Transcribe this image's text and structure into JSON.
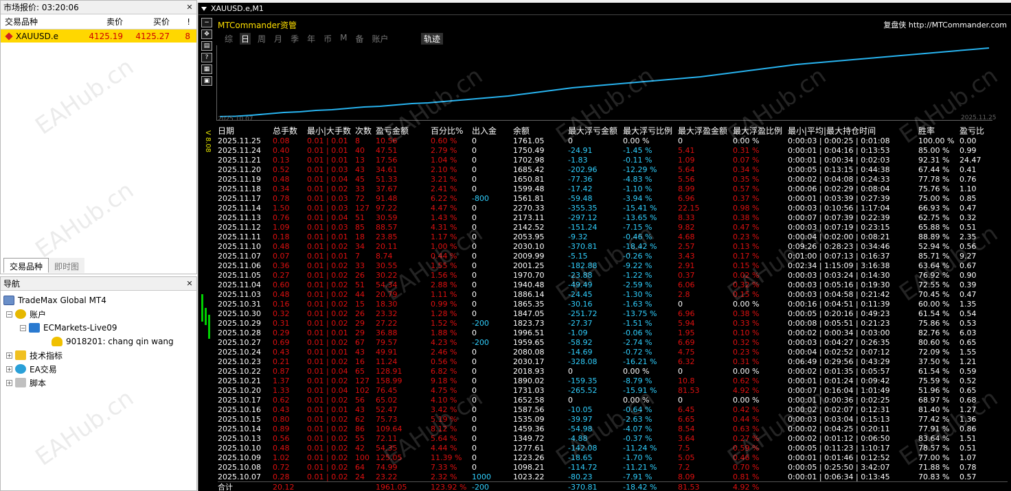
{
  "market_watch": {
    "title": "市场报价: 03:20:06",
    "columns": [
      "交易品种",
      "卖价",
      "买价",
      "!"
    ],
    "rows": [
      {
        "symbol": "XAUUSD.e",
        "bid": "4125.19",
        "ask": "4125.27",
        "spread": "8"
      }
    ],
    "tabs": [
      "交易品种",
      "即时图"
    ]
  },
  "navigator": {
    "title": "导航",
    "tree": {
      "terminal": "TradeMax Global MT4",
      "accounts": "账户",
      "server": "ECMarkets-Live09",
      "user": "9018201: chang qin wang",
      "indicators": "技术指标",
      "ea": "EA交易",
      "scripts": "脚本"
    }
  },
  "chart": {
    "title": "XAUUSD.e,M1",
    "brand": "MTCommander资管",
    "brand_right_label": "复盘侠",
    "brand_right_url": "http://MTCommander.com",
    "price_label": "V 8.08",
    "periods": [
      "综",
      "日",
      "周",
      "月",
      "季",
      "年",
      "币",
      "M",
      "备",
      "账户"
    ],
    "active_period": "日",
    "track": "轨迹",
    "date_start": "2025.10.07",
    "date_end": "2025.11.25",
    "watermark": "EAHub.cn"
  },
  "chart_data": {
    "type": "line",
    "series": [
      {
        "values": [
          0,
          0.5,
          2,
          4,
          6,
          7,
          9,
          10,
          12,
          14,
          15,
          17,
          19,
          20,
          22,
          24,
          26,
          28,
          30,
          33,
          36,
          39,
          42,
          44,
          46,
          48,
          50,
          52,
          54,
          56,
          58,
          61,
          64,
          67,
          70,
          73,
          76,
          78,
          80,
          82,
          84,
          86,
          88,
          90,
          92,
          94,
          96,
          98,
          100
        ]
      }
    ],
    "xlabel": "",
    "ylabel": "",
    "ylim": [
      0,
      100
    ]
  },
  "table": {
    "headers": [
      "日期",
      "总手数",
      "最小|大手数",
      "次数",
      "盈亏金额",
      "百分比%",
      "出入金",
      "余额",
      "最大浮亏金额",
      "最大浮亏比例",
      "最大浮盈金额",
      "最大浮盈比例",
      "最小|平均|最大持仓时间",
      "胜率",
      "盈亏比"
    ],
    "rows": [
      [
        "2025.11.25",
        "0.08",
        "0.01 | 0.01",
        "8",
        "10.56",
        "0.60 %",
        "0",
        "1761.05",
        "0",
        "0.00 %",
        "0",
        "0.00 %",
        "0:00:03 | 0:00:25 | 0:01:08",
        "100.00 %",
        "0.00"
      ],
      [
        "2025.11.24",
        "0.40",
        "0.01 | 0.01",
        "40",
        "47.51",
        "2.79 %",
        "0",
        "1750.49",
        "-24.91",
        "-1.45 %",
        "5.41",
        "0.31 %",
        "0:00:01 | 0:04:16 | 0:13:53",
        "85.00 %",
        "0.99"
      ],
      [
        "2025.11.21",
        "0.13",
        "0.01 | 0.01",
        "13",
        "17.56",
        "1.04 %",
        "0",
        "1702.98",
        "-1.83",
        "-0.11 %",
        "1.09",
        "0.07 %",
        "0:00:01 | 0:00:34 | 0:02:03",
        "92.31 %",
        "24.47"
      ],
      [
        "2025.11.20",
        "0.52",
        "0.01 | 0.03",
        "43",
        "34.61",
        "2.10 %",
        "0",
        "1685.42",
        "-202.96",
        "-12.29 %",
        "5.64",
        "0.34 %",
        "0:00:05 | 0:13:15 | 0:44:38",
        "67.44 %",
        "0.41"
      ],
      [
        "2025.11.19",
        "0.48",
        "0.01 | 0.04",
        "45",
        "51.33",
        "3.21 %",
        "0",
        "1650.81",
        "-77.36",
        "-4.83 %",
        "5.56",
        "0.35 %",
        "0:00:02 | 0:04:08 | 0:24:33",
        "77.78 %",
        "0.76"
      ],
      [
        "2025.11.18",
        "0.34",
        "0.01 | 0.02",
        "33",
        "37.67",
        "2.41 %",
        "0",
        "1599.48",
        "-17.42",
        "-1.10 %",
        "8.99",
        "0.57 %",
        "0:00:06 | 0:02:29 | 0:08:04",
        "75.76 %",
        "1.10"
      ],
      [
        "2025.11.17",
        "0.78",
        "0.01 | 0.03",
        "72",
        "91.48",
        "6.22 %",
        "-800",
        "1561.81",
        "-59.48",
        "-3.94 %",
        "6.96",
        "0.37 %",
        "0:00:01 | 0:03:39 | 0:27:39",
        "75.00 %",
        "0.85"
      ],
      [
        "2025.11.14",
        "1.50",
        "0.01 | 0.03",
        "127",
        "97.22",
        "4.47 %",
        "0",
        "2270.33",
        "-355.35",
        "-15.41 %",
        "22.15",
        "0.98 %",
        "0:00:03 | 0:10:56 | 1:17:04",
        "66.93 %",
        "0.47"
      ],
      [
        "2025.11.13",
        "0.76",
        "0.01 | 0.04",
        "51",
        "30.59",
        "1.43 %",
        "0",
        "2173.11",
        "-297.12",
        "-13.65 %",
        "8.33",
        "0.38 %",
        "0:00:07 | 0:07:39 | 0:22:39",
        "62.75 %",
        "0.32"
      ],
      [
        "2025.11.12",
        "1.09",
        "0.01 | 0.03",
        "85",
        "88.57",
        "4.31 %",
        "0",
        "2142.52",
        "-151.24",
        "-7.15 %",
        "9.82",
        "0.47 %",
        "0:00:03 | 0:07:19 | 0:23:15",
        "65.88 %",
        "0.51"
      ],
      [
        "2025.11.11",
        "0.18",
        "0.01 | 0.01",
        "18",
        "23.85",
        "1.17 %",
        "0",
        "2053.95",
        "-9.32",
        "-0.46 %",
        "4.68",
        "0.23 %",
        "0:00:04 | 0:02:00 | 0:08:21",
        "88.89 %",
        "2.35"
      ],
      [
        "2025.11.10",
        "0.48",
        "0.01 | 0.02",
        "34",
        "20.11",
        "1.00 %",
        "0",
        "2030.10",
        "-370.81",
        "-18.42 %",
        "2.57",
        "0.13 %",
        "0:09:26 | 0:28:23 | 0:34:46",
        "52.94 %",
        "0.56"
      ],
      [
        "2025.11.07",
        "0.07",
        "0.01 | 0.01",
        "7",
        "8.74",
        "0.44 %",
        "0",
        "2009.99",
        "-5.15",
        "-0.26 %",
        "3.43",
        "0.17 %",
        "0:01:00 | 0:07:13 | 0:16:37",
        "85.71 %",
        "9.27"
      ],
      [
        "2025.11.06",
        "0.36",
        "0.01 | 0.02",
        "33",
        "30.55",
        "1.55 %",
        "0",
        "2001.25",
        "-182.88",
        "-9.22 %",
        "2.91",
        "0.15 %",
        "0:02:34 | 1:15:09 | 3:16:38",
        "63.64 %",
        "0.67"
      ],
      [
        "2025.11.05",
        "0.27",
        "0.01 | 0.02",
        "26",
        "30.22",
        "1.56 %",
        "0",
        "1970.70",
        "-23.88",
        "-1.22 %",
        "0.37",
        "0.02 %",
        "0:00:03 | 0:03:24 | 0:14:30",
        "76.92 %",
        "0.90"
      ],
      [
        "2025.11.04",
        "0.60",
        "0.01 | 0.02",
        "51",
        "54.34",
        "2.88 %",
        "0",
        "1940.48",
        "-49.49",
        "-2.59 %",
        "6.06",
        "0.32 %",
        "0:00:03 | 0:05:16 | 0:19:30",
        "72.55 %",
        "0.39"
      ],
      [
        "2025.11.03",
        "0.48",
        "0.01 | 0.02",
        "44",
        "20.79",
        "1.11 %",
        "0",
        "1886.14",
        "-24.45",
        "-1.30 %",
        "2.8",
        "0.15 %",
        "0:00:03 | 0:04:58 | 0:21:42",
        "70.45 %",
        "0.47"
      ],
      [
        "2025.10.31",
        "0.16",
        "0.01 | 0.02",
        "15",
        "18.30",
        "0.99 %",
        "0",
        "1865.35",
        "-30.16",
        "-1.63 %",
        "0",
        "0.00 %",
        "0:00:16 | 0:04:51 | 0:11:39",
        "60.00 %",
        "1.35"
      ],
      [
        "2025.10.30",
        "0.32",
        "0.01 | 0.02",
        "26",
        "23.32",
        "1.28 %",
        "0",
        "1847.05",
        "-251.72",
        "-13.75 %",
        "6.96",
        "0.38 %",
        "0:00:05 | 0:20:16 | 0:49:23",
        "61.54 %",
        "0.54"
      ],
      [
        "2025.10.29",
        "0.31",
        "0.01 | 0.02",
        "29",
        "27.22",
        "1.52 %",
        "-200",
        "1823.73",
        "-27.37",
        "-1.51 %",
        "5.94",
        "0.33 %",
        "0:00:08 | 0:05:51 | 0:21:23",
        "75.86 %",
        "0.53"
      ],
      [
        "2025.10.28",
        "0.29",
        "0.01 | 0.01",
        "29",
        "36.88",
        "1.88 %",
        "0",
        "1996.51",
        "-1.09",
        "-0.06 %",
        "1.95",
        "0.10 %",
        "0:00:02 | 0:00:34 | 0:03:00",
        "82.76 %",
        "6.03"
      ],
      [
        "2025.10.27",
        "0.69",
        "0.01 | 0.02",
        "67",
        "79.57",
        "4.23 %",
        "-200",
        "1959.65",
        "-58.92",
        "-2.74 %",
        "6.69",
        "0.32 %",
        "0:00:03 | 0:04:27 | 0:26:35",
        "80.60 %",
        "0.65"
      ],
      [
        "2025.10.24",
        "0.43",
        "0.01 | 0.01",
        "43",
        "49.91",
        "2.46 %",
        "0",
        "2080.08",
        "-14.69",
        "-0.72 %",
        "4.75",
        "0.23 %",
        "0:00:04 | 0:02:52 | 0:07:12",
        "72.09 %",
        "1.55"
      ],
      [
        "2025.10.23",
        "0.21",
        "0.01 | 0.02",
        "16",
        "11.24",
        "0.56 %",
        "0",
        "2030.17",
        "-328.08",
        "-16.21 %",
        "6.32",
        "0.31 %",
        "0:06:49 | 0:29:56 | 0:43:29",
        "37.50 %",
        "1.21"
      ],
      [
        "2025.10.22",
        "0.87",
        "0.01 | 0.04",
        "65",
        "128.91",
        "6.82 %",
        "0",
        "2018.93",
        "0",
        "0.00 %",
        "0",
        "0.00 %",
        "0:00:02 | 0:01:35 | 0:05:57",
        "61.54 %",
        "0.59"
      ],
      [
        "2025.10.21",
        "1.37",
        "0.01 | 0.02",
        "127",
        "158.99",
        "9.18 %",
        "0",
        "1890.02",
        "-159.35",
        "-8.79 %",
        "10.8",
        "0.62 %",
        "0:00:01 | 0:01:24 | 0:09:42",
        "75.59 %",
        "0.52"
      ],
      [
        "2025.10.20",
        "1.33",
        "0.01 | 0.04",
        "102",
        "76.45",
        "4.75 %",
        "0",
        "1731.03",
        "-265.52",
        "-15.91 %",
        "81.53",
        "4.92 %",
        "0:00:07 | 0:16:04 | 1:01:49",
        "51.96 %",
        "0.65"
      ],
      [
        "2025.10.17",
        "0.62",
        "0.01 | 0.02",
        "56",
        "65.02",
        "4.10 %",
        "0",
        "1652.58",
        "0",
        "0.00 %",
        "0",
        "0.00 %",
        "0:00:01 | 0:00:36 | 0:02:25",
        "68.97 %",
        "0.68"
      ],
      [
        "2025.10.16",
        "0.43",
        "0.01 | 0.01",
        "43",
        "52.47",
        "3.42 %",
        "0",
        "1587.56",
        "-10.05",
        "-0.64 %",
        "6.45",
        "0.42 %",
        "0:00:02 | 0:02:07 | 0:12:31",
        "81.40 %",
        "1.27"
      ],
      [
        "2025.10.15",
        "0.80",
        "0.01 | 0.02",
        "62",
        "75.73",
        "5.19 %",
        "0",
        "1535.09",
        "-39.97",
        "-2.63 %",
        "6.65",
        "0.44 %",
        "0:00:03 | 0:03:04 | 0:15:13",
        "77.42 %",
        "1.36"
      ],
      [
        "2025.10.14",
        "0.89",
        "0.01 | 0.02",
        "86",
        "109.64",
        "8.12 %",
        "0",
        "1459.36",
        "-54.98",
        "-4.07 %",
        "8.54",
        "0.63 %",
        "0:00:02 | 0:04:25 | 0:20:11",
        "77.91 %",
        "0.86"
      ],
      [
        "2025.10.13",
        "0.56",
        "0.01 | 0.02",
        "55",
        "72.11",
        "5.64 %",
        "0",
        "1349.72",
        "-4.88",
        "-0.37 %",
        "3.64",
        "0.27 %",
        "0:00:02 | 0:01:12 | 0:06:50",
        "83.64 %",
        "1.51"
      ],
      [
        "2025.10.10",
        "0.48",
        "0.01 | 0.02",
        "42",
        "54.35",
        "4.44 %",
        "0",
        "1277.61",
        "-142.08",
        "-11.24 %",
        "7.5",
        "0.59 %",
        "0:00:05 | 0:11:23 | 1:10:17",
        "78.57 %",
        "0.51"
      ],
      [
        "2025.10.09",
        "1.02",
        "0.01 | 0.02",
        "100",
        "125.05",
        "11.39 %",
        "0",
        "1223.26",
        "-18.65",
        "-1.70 %",
        "5.05",
        "0.46 %",
        "0:00:01 | 0:01:46 | 0:12:52",
        "77.00 %",
        "1.07"
      ],
      [
        "2025.10.08",
        "0.72",
        "0.01 | 0.02",
        "64",
        "74.99",
        "7.33 %",
        "0",
        "1098.21",
        "-114.72",
        "-11.21 %",
        "7.2",
        "0.70 %",
        "0:00:05 | 0:25:50 | 3:42:07",
        "71.88 %",
        "0.78"
      ],
      [
        "2025.10.07",
        "0.28",
        "0.01 | 0.02",
        "24",
        "23.22",
        "2.32 %",
        "1000",
        "1023.22",
        "-80.23",
        "-7.91 %",
        "8.09",
        "0.81 %",
        "0:00:01 | 0:06:34 | 0:13:45",
        "70.83 %",
        "0.57"
      ]
    ],
    "total": [
      "合计",
      "20.12",
      "",
      "",
      "1961.05",
      "123.92 %",
      "-200",
      "",
      "-370.81",
      "-18.42 %",
      "81.53",
      "4.92 %",
      "",
      "",
      ""
    ]
  }
}
